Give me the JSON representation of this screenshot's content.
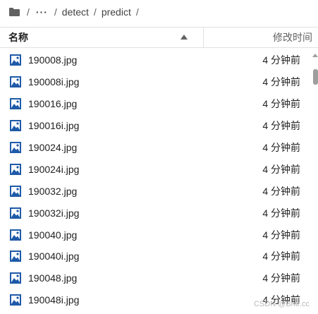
{
  "breadcrumb": {
    "ellipsis": "···",
    "items": [
      "detect",
      "predict"
    ],
    "separator": "/"
  },
  "header": {
    "name_label": "名称",
    "modified_label": "修改时间"
  },
  "files": [
    {
      "name": "190008.jpg",
      "modified": "4 分钟前"
    },
    {
      "name": "190008i.jpg",
      "modified": "4 分钟前"
    },
    {
      "name": "190016.jpg",
      "modified": "4 分钟前"
    },
    {
      "name": "190016i.jpg",
      "modified": "4 分钟前"
    },
    {
      "name": "190024.jpg",
      "modified": "4 分钟前"
    },
    {
      "name": "190024i.jpg",
      "modified": "4 分钟前"
    },
    {
      "name": "190032.jpg",
      "modified": "4 分钟前"
    },
    {
      "name": "190032i.jpg",
      "modified": "4 分钟前"
    },
    {
      "name": "190040.jpg",
      "modified": "4 分钟前"
    },
    {
      "name": "190040i.jpg",
      "modified": "4 分钟前"
    },
    {
      "name": "190048.jpg",
      "modified": "4 分钟前"
    },
    {
      "name": "190048i.jpg",
      "modified": "4 分钟前"
    }
  ],
  "watermark": "CSDN @Bne.cc",
  "colors": {
    "file_icon": "#1e5aa8",
    "folder_icon": "#616161",
    "border": "#e0e0e0",
    "text": "#212121"
  },
  "icons": {
    "folder": "folder-icon",
    "file": "image-file-icon",
    "sort": "sort-ascending-icon"
  }
}
